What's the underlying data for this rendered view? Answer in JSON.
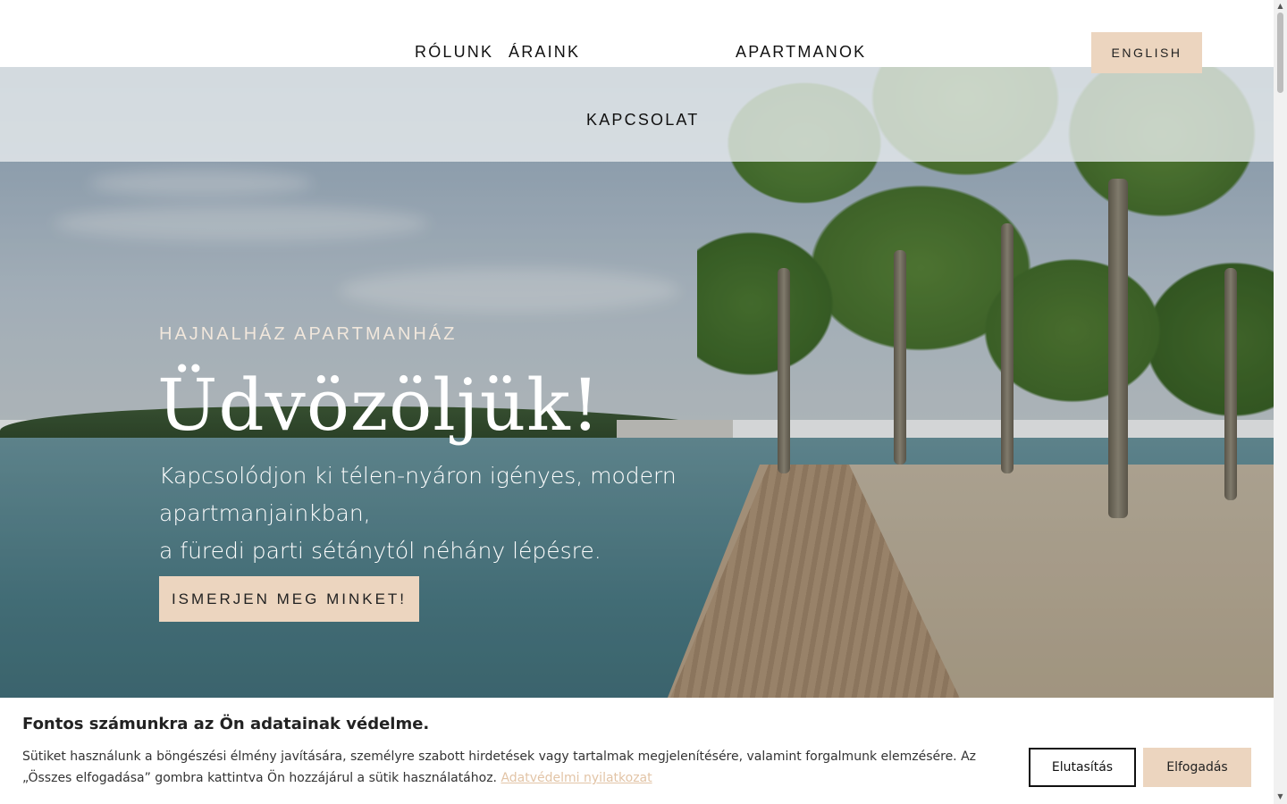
{
  "nav": {
    "items": [
      "RÓLUNK",
      "ÁRAINK",
      "APARTMANOK",
      "KAPCSOLAT"
    ],
    "lang_button": "ENGLISH"
  },
  "hero": {
    "kicker": "HAJNALHÁZ APARTMANHÁZ",
    "title": "Üdvözöljük!",
    "subtitle_line1": "Kapcsolódjon ki télen-nyáron igényes, modern apartmanjainkban,",
    "subtitle_line2": "a füredi parti sétánytól néhány lépésre.",
    "cta": "ISMERJEN MEG MINKET!"
  },
  "cookie": {
    "title": "Fontos számunkra az Ön adatainak védelme.",
    "text": "Sütiket használunk a böngészési élmény javítására, személyre szabott hirdetések vagy tartalmak megjelenítésére, valamint forgalmunk elemzésére. Az „Összes elfogadása” gombra kattintva Ön hozzájárul a sütik használatához.",
    "link": "Adatvédelmi nyilatkozat",
    "reject": "Elutasítás",
    "accept": "Elfogadás"
  },
  "colors": {
    "accent": "#ecd5bf",
    "link": "#e2c4a6"
  },
  "icons": {
    "scroll_up": "triangle-up-icon",
    "scroll_down": "triangle-down-icon"
  }
}
